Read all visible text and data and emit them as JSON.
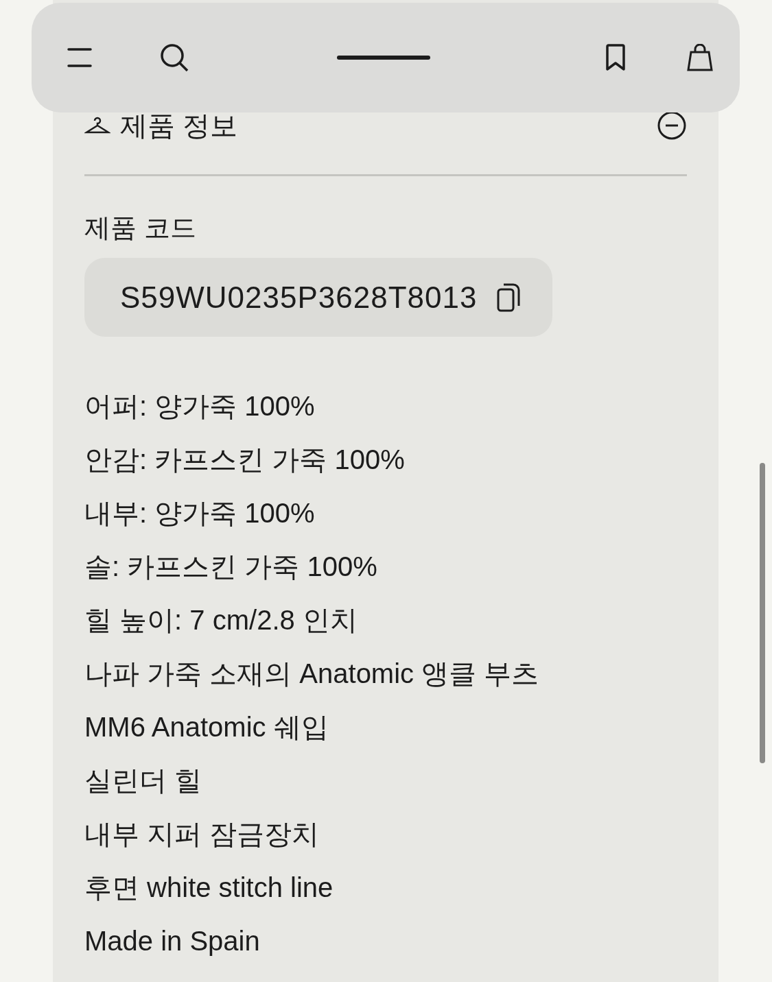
{
  "section": {
    "title": "제품 정보",
    "expanded": true
  },
  "product_code": {
    "label": "제품 코드",
    "value": "S59WU0235P3628T8013"
  },
  "details": [
    "어퍼: 양가죽 100%",
    "안감: 카프스킨 가죽 100%",
    "내부: 양가죽 100%",
    "솔: 카프스킨 가죽 100%",
    "힐 높이: 7 cm/2.8 인치",
    "나파 가죽 소재의 Anatomic 앵클 부츠",
    "MM6 Anatomic 쉐입",
    "실린더 힐",
    "내부 지퍼 잠금장치",
    "후면 white stitch line",
    "Made in Spain"
  ]
}
